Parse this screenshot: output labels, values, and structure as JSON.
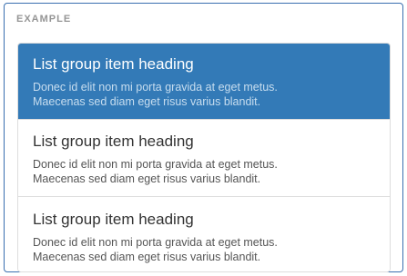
{
  "example": {
    "label": "EXAMPLE"
  },
  "colors": {
    "active_background": "#337ab7",
    "active_heading": "#ffffff",
    "active_text": "#c7ddef",
    "heading": "#333333",
    "text": "#555555",
    "panel_border": "#3a6fb0"
  },
  "list_group": {
    "items": [
      {
        "heading": "List group item heading",
        "text_line1": "Donec id elit non mi porta gravida at eget metus.",
        "text_line2": "Maecenas sed diam eget risus varius blandit.",
        "active": true
      },
      {
        "heading": "List group item heading",
        "text_line1": "Donec id elit non mi porta gravida at eget metus.",
        "text_line2": "Maecenas sed diam eget risus varius blandit.",
        "active": false
      },
      {
        "heading": "List group item heading",
        "text_line1": "Donec id elit non mi porta gravida at eget metus.",
        "text_line2": "Maecenas sed diam eget risus varius blandit.",
        "active": false
      }
    ]
  }
}
